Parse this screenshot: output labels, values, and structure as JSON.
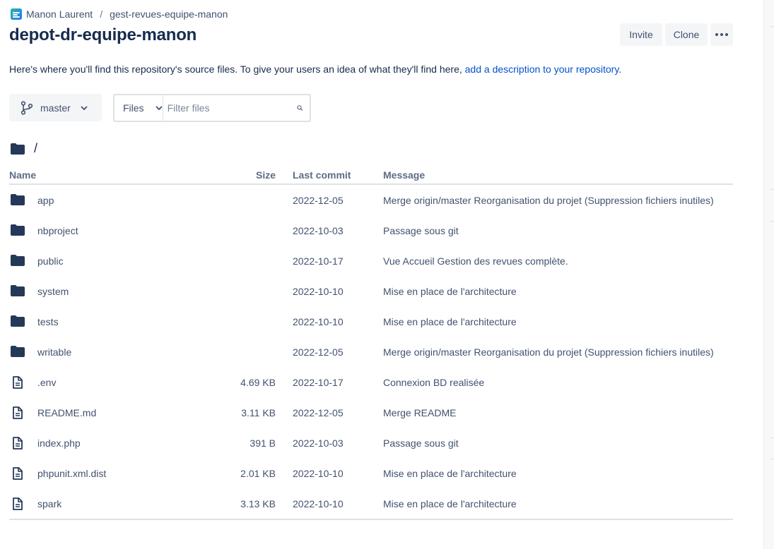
{
  "breadcrumb": {
    "workspace": "Manon Laurent",
    "separator": "/",
    "project": "gest-revues-equipe-manon"
  },
  "page_title": "depot-dr-equipe-manon",
  "actions": {
    "invite_label": "Invite",
    "clone_label": "Clone",
    "more_icon": "more-horizontal-icon"
  },
  "description": {
    "text": "Here's where you'll find this repository's source files. To give your users an idea of what they'll find here, ",
    "link_text": "add a description to your repository",
    "suffix": "."
  },
  "branch": {
    "label": "master"
  },
  "file_filter": {
    "mode": "Files",
    "placeholder": "Filter files"
  },
  "path": "/",
  "table": {
    "headers": {
      "name": "Name",
      "size": "Size",
      "last_commit": "Last commit",
      "message": "Message"
    },
    "rows": [
      {
        "type": "folder",
        "name": "app",
        "size": "",
        "date": "2022-12-05",
        "message": "Merge origin/master Reorganisation du projet (Suppression fichiers inutiles)"
      },
      {
        "type": "folder",
        "name": "nbproject",
        "size": "",
        "date": "2022-10-03",
        "message": "Passage sous git"
      },
      {
        "type": "folder",
        "name": "public",
        "size": "",
        "date": "2022-10-17",
        "message": "Vue Accueil Gestion des revues complète."
      },
      {
        "type": "folder",
        "name": "system",
        "size": "",
        "date": "2022-10-10",
        "message": "Mise en place de l'architecture"
      },
      {
        "type": "folder",
        "name": "tests",
        "size": "",
        "date": "2022-10-10",
        "message": "Mise en place de l'architecture"
      },
      {
        "type": "folder",
        "name": "writable",
        "size": "",
        "date": "2022-12-05",
        "message": "Merge origin/master Reorganisation du projet (Suppression fichiers inutiles)"
      },
      {
        "type": "file",
        "name": ".env",
        "size": "4.69 KB",
        "date": "2022-10-17",
        "message": "Connexion BD realisée"
      },
      {
        "type": "file",
        "name": "README.md",
        "size": "3.11 KB",
        "date": "2022-12-05",
        "message": "Merge README"
      },
      {
        "type": "file",
        "name": "index.php",
        "size": "391 B",
        "date": "2022-10-03",
        "message": "Passage sous git"
      },
      {
        "type": "file",
        "name": "phpunit.xml.dist",
        "size": "2.01 KB",
        "date": "2022-10-10",
        "message": "Mise en place de l'architecture"
      },
      {
        "type": "file",
        "name": "spark",
        "size": "3.13 KB",
        "date": "2022-10-10",
        "message": "Mise en place de l'architecture"
      }
    ]
  },
  "colors": {
    "text": "#172B4D",
    "secondary_text": "#42526E",
    "link": "#0052CC",
    "button_bg": "#F4F5F7",
    "folder_icon": "#253858",
    "border": "#DFE1E6"
  }
}
